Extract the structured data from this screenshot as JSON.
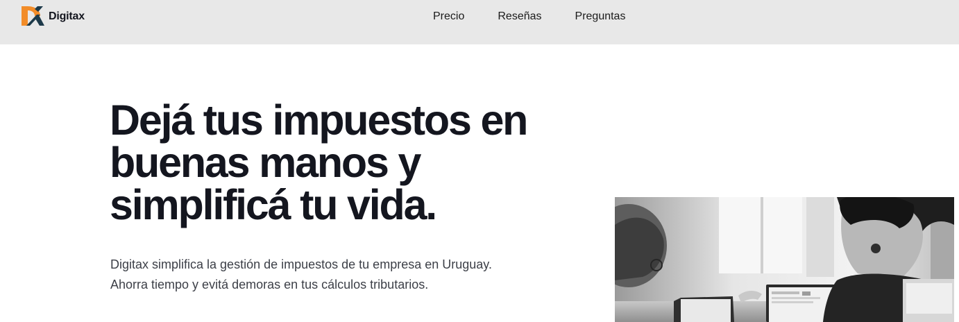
{
  "header": {
    "brand_name": "Digitax",
    "logo_icon": "digitax-dx-logo",
    "nav": [
      {
        "label": "Precio"
      },
      {
        "label": "Reseñas"
      },
      {
        "label": "Preguntas"
      }
    ]
  },
  "hero": {
    "title": "Dejá tus impuestos en buenas manos y simplificá tu vida.",
    "subtitle_line1": "Digitax simplifica la gestión de impuestos de tu empresa en Uruguay.",
    "subtitle_line2": "Ahorra tiempo y evitá demoras en tus cálculos tributarios.",
    "image": "grayscale-office-photo"
  },
  "colors": {
    "nav_background": "#e8e8e8",
    "title": "#14161f",
    "body_text": "#3c3f47",
    "logo_orange": "#f28c28",
    "logo_dark": "#1d3a4a"
  }
}
